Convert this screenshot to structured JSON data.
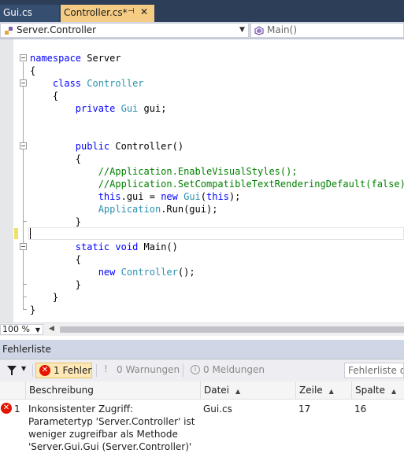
{
  "tabs": [
    {
      "label": "Gui.cs"
    },
    {
      "label": "Controller.cs*"
    }
  ],
  "navbar": {
    "left": "Server.Controller",
    "right": "Main()"
  },
  "code": [
    "namespace Server",
    "{",
    "    class Controller",
    "    {",
    "        private Gui gui;",
    "",
    "",
    "        public Controller()",
    "        {",
    "            //Application.EnableVisualStyles();",
    "            //Application.SetCompatibleTextRenderingDefault(false);",
    "            this.gui = new Gui(this);",
    "            Application.Run(gui);",
    "        }",
    "",
    "        static void Main()",
    "        {",
    "            new Controller();",
    "        }",
    "    }",
    "}"
  ],
  "zoom": "100 %",
  "error_list": {
    "title": "Fehlerliste",
    "errors_label": "1 Fehler",
    "warnings_label": "0 Warnungen",
    "messages_label": "0 Meldungen",
    "search_placeholder": "Fehlerliste durchsuchen",
    "columns": {
      "description": "Beschreibung",
      "file": "Datei",
      "line": "Zeile",
      "column": "Spalte"
    },
    "rows": [
      {
        "index": "1",
        "description": "Inkonsistenter Zugriff: Parametertyp 'Server.Controller' ist weniger zugreifbar als Methode 'Server.Gui.Gui (Server.Controller)'",
        "file": "Gui.cs",
        "line": "17",
        "column": "16"
      }
    ]
  },
  "colors": {
    "tabbar_bg": "#2d3e58",
    "active_tab_bg": "#f5cc84",
    "keyword": "#0000ff",
    "type": "#2b91af",
    "comment": "#008000",
    "error_red": "#e51400"
  }
}
